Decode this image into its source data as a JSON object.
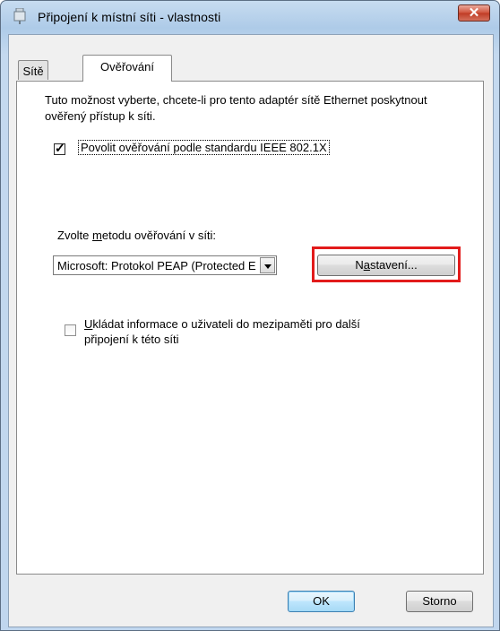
{
  "window": {
    "title": "Připojení k místní síti - vlastnosti",
    "close_label": "✕"
  },
  "tabs": [
    {
      "label": "Sítě",
      "active": false
    },
    {
      "label": "Ověřování",
      "active": true
    }
  ],
  "auth": {
    "description": "Tuto možnost vyberte, chcete-li pro tento adaptér sítě Ethernet poskytnout ověřený přístup k síti.",
    "enable_8021x": {
      "label": "Povolit ověřování podle standardu IEEE 802.1X",
      "checked": true
    },
    "method_label_pre": "Zvolte ",
    "method_label_u": "m",
    "method_label_post": "etodu ověřování v síti:",
    "method_selected": "Microsoft: Protokol PEAP (Protected EAP)",
    "settings_pre": "N",
    "settings_u": "a",
    "settings_post": "stavení...",
    "cache_u": "U",
    "cache_label": "kládat informace o uživateli do mezipaměti pro další připojení k této síti",
    "cache_checked": false
  },
  "buttons": {
    "ok": "OK",
    "cancel": "Storno"
  },
  "colors": {
    "highlight": "#e21b1b",
    "close_button": "#d0513a"
  }
}
